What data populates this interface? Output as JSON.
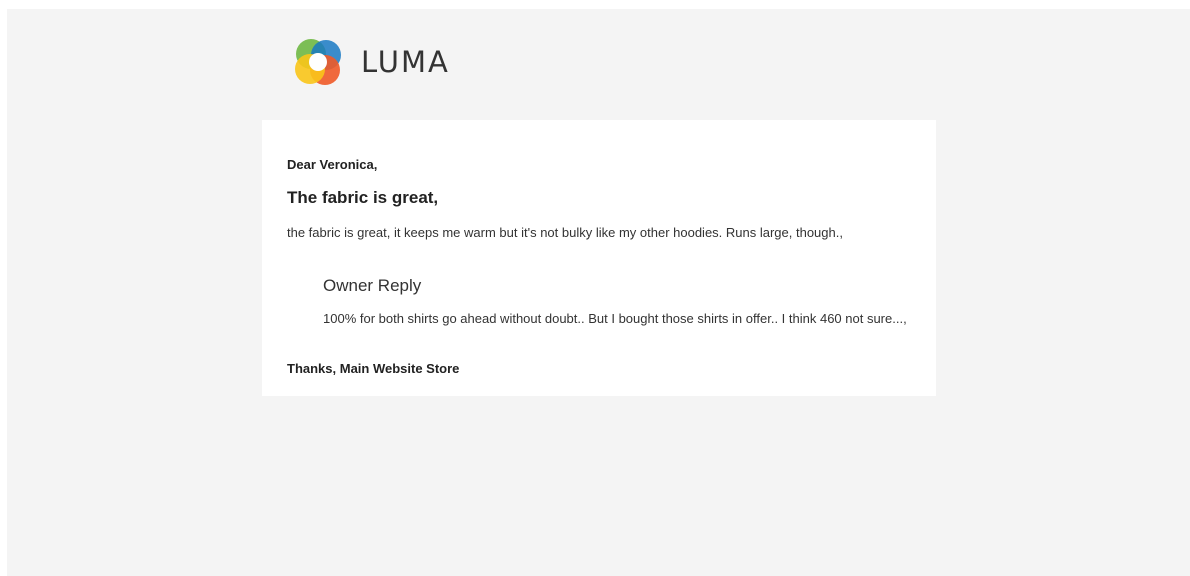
{
  "header": {
    "logo_text": "LUMA",
    "logo_icon": "luma-logo-icon"
  },
  "email": {
    "greeting": "Dear Veronica,",
    "review_title": "The fabric is great,",
    "review_body": "the fabric is great, it keeps me warm but it's not bulky like my other hoodies. Runs large, though.,",
    "reply_title": "Owner Reply",
    "reply_body": "100% for both shirts go ahead without doubt.. But I bought those shirts in offer.. I think 460 not sure...,",
    "signoff": "Thanks, Main Website Store"
  },
  "colors": {
    "page_background": "#f4f4f4",
    "card_background": "#ffffff",
    "logo_green": "#6fb844",
    "logo_blue": "#1979c3",
    "logo_orange": "#ef5a28",
    "logo_yellow": "#f9c51a"
  }
}
